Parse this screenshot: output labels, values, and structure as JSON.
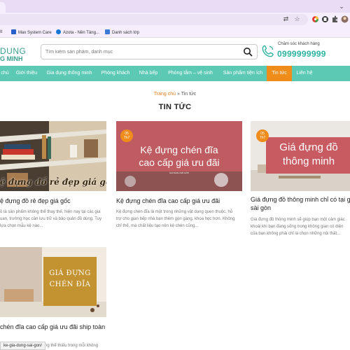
{
  "browser": {
    "bookmarks": [
      {
        "label": "It",
        "color": "#4a6fd1"
      },
      {
        "label": "Max System Care",
        "color": "#2b5fc9"
      },
      {
        "label": "Azota - Nền Tảng...",
        "color": "#1976d2"
      },
      {
        "label": "Danh sách lớp",
        "color": "#3d7bd8"
      }
    ],
    "status_url": "ke-gia-dung-sai-gon/"
  },
  "header": {
    "logo_line1": "DUNG",
    "logo_line2": "G MINH",
    "search_placeholder": "Tìm kiếm sản phẩm, danh mục",
    "care_label": "Chăm sóc khách hàng",
    "care_phone": "0999999999"
  },
  "nav": {
    "items": [
      {
        "label": "chủ"
      },
      {
        "label": "Giới thiệu"
      },
      {
        "label": "Gia dụng thông minh"
      },
      {
        "label": "Phòng khách"
      },
      {
        "label": "Nhà bếp"
      },
      {
        "label": "Phòng tắm – vệ sinh"
      },
      {
        "label": "Sản phẩm tiện ích"
      },
      {
        "label": "Tin tức",
        "active": true
      },
      {
        "label": "Liên hệ"
      }
    ]
  },
  "breadcrumb": {
    "home": "Trang chủ",
    "sep": " » ",
    "current": "Tin tức"
  },
  "page_title": "TIN TỨC",
  "articles": [
    {
      "title": "ệ đựng đồ rẻ đẹp giá gốc",
      "desc_lines": [
        "ồ là sản phẩm không thể thay thế, hiện nay tại các gia",
        "uan, trường học cần lưu trữ và bảo quản đồ dùng. Tuy",
        "lựa chọn mẫu kệ nào..."
      ],
      "image_text": "ệ đựng đồ rẻ đẹp giá gốc"
    },
    {
      "title": "Kệ đựng chén đĩa cao cấp giá ưu đãi",
      "desc_lines": [
        "Kệ đựng chén đĩa là một trong những vật dụng quen thuộc, hỗ",
        "trợ cho gian bếp nhà bạn thêm gọn gàng, khoa học hơn. Không",
        "chỉ thế, mà chất liệu tạo nên kệ chén cũng..."
      ],
      "date_day": "05",
      "date_month": "Th7",
      "image_line1": "Kệ đựng chén đĩa",
      "image_line2": "cao cấp giá ưu đãi",
      "image_small": "GIA DANH SÀI GÒN"
    },
    {
      "title_lines": [
        "Giá đựng đồ thông minh chỉ có tại gia",
        "sài gòn"
      ],
      "desc_lines": [
        "Giá đựng đồ thông minh sẽ giúp bạn một cảm giác",
        "khoái khi bạn đang sống trong không gian có diện",
        "của bạn không phải chỉ là chọn những nội thất..."
      ],
      "date_day": "05",
      "date_month": "Th7",
      "image_line1": "Giá đựng đồ",
      "image_line2": "thông minh"
    },
    {
      "title": "chén đĩa cao cấp giá ưu đãi ship toàn",
      "desc": "ng thể thiếu trong mỗi không",
      "image_line1": "GIÁ ĐỰNG",
      "image_line2": "CHÉN ĐĨA"
    }
  ]
}
